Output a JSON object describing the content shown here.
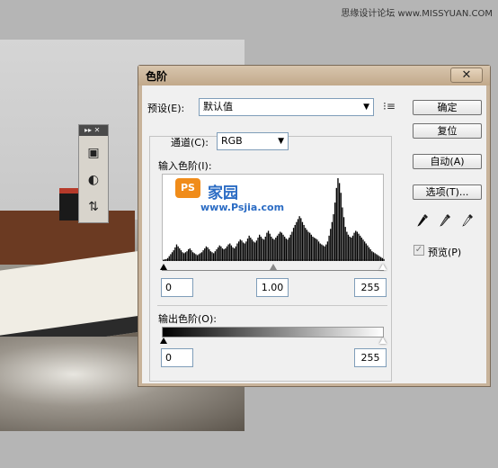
{
  "watermark": "思缘设计论坛  www.MISSYUAN.COM",
  "tool_panel": {
    "header": "▸▸ ✕",
    "icons": [
      "rectangle-icon",
      "circle-half-icon",
      "adjust-icon"
    ]
  },
  "dialog": {
    "title": "色阶",
    "close_label": "✕",
    "preset_label": "预设(E):",
    "preset_value": "默认值",
    "channel_label": "通道(C):",
    "channel_value": "RGB",
    "input_levels_label": "输入色阶(I):",
    "input_black": "0",
    "input_gamma": "1.00",
    "input_white": "255",
    "output_levels_label": "输出色阶(O):",
    "output_black": "0",
    "output_white": "255",
    "buttons": {
      "ok": "确定",
      "reset": "复位",
      "auto": "自动(A)",
      "options": "选项(T)..."
    },
    "preview_label": "预览(P)",
    "preview_checked": true
  },
  "histogram_logo": {
    "badge": "PS",
    "brand": "家园",
    "url": "www.Psjia.com"
  },
  "histogram_data": {
    "type": "histogram",
    "bins": 256,
    "profile": [
      2,
      3,
      4,
      6,
      10,
      14,
      18,
      22,
      28,
      34,
      30,
      26,
      22,
      18,
      16,
      18,
      20,
      24,
      26,
      22,
      18,
      16,
      14,
      12,
      14,
      16,
      18,
      22,
      26,
      30,
      28,
      24,
      20,
      18,
      16,
      20,
      24,
      28,
      32,
      30,
      26,
      24,
      26,
      30,
      34,
      36,
      32,
      28,
      26,
      30,
      36,
      40,
      44,
      42,
      38,
      36,
      40,
      46,
      52,
      48,
      44,
      40,
      38,
      42,
      48,
      54,
      50,
      46,
      44,
      50,
      58,
      62,
      56,
      50,
      46,
      44,
      48,
      52,
      56,
      60,
      58,
      54,
      50,
      46,
      44,
      48,
      54,
      60,
      68,
      74,
      80,
      86,
      92,
      88,
      80,
      74,
      68,
      64,
      60,
      58,
      54,
      50,
      48,
      46,
      44,
      40,
      36,
      34,
      32,
      30,
      34,
      40,
      52,
      66,
      80,
      96,
      120,
      150,
      170,
      160,
      140,
      110,
      90,
      70,
      60,
      54,
      50,
      48,
      52,
      58,
      62,
      60,
      56,
      52,
      48,
      44,
      40,
      36,
      32,
      28,
      24,
      20,
      18,
      16,
      14,
      12,
      10,
      8,
      6,
      4
    ]
  },
  "colors": {
    "dialog_frame": "#c8b39a",
    "client_bg": "#f0f0f0",
    "brand_blue": "#2b6cc4",
    "badge_orange": "#f08c1a"
  }
}
